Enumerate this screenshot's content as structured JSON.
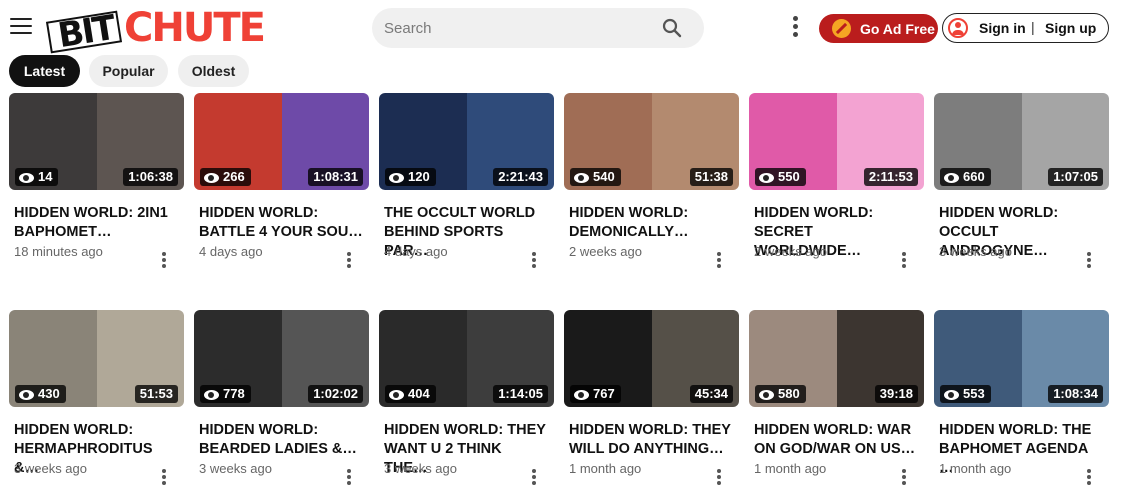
{
  "header": {
    "logo_text_1": "BIT",
    "logo_text_2": "CHUTE",
    "search_placeholder": "Search",
    "go_ad_free": "Go Ad Free",
    "sign_in": "Sign in",
    "separator": "|",
    "sign_up": "Sign up"
  },
  "colors": {
    "brand_red": "#ef4136",
    "ad_button": "#ba1d1d"
  },
  "tabs": [
    {
      "label": "Latest",
      "active": true
    },
    {
      "label": "Popular",
      "active": false
    },
    {
      "label": "Oldest",
      "active": false
    }
  ],
  "videos": [
    {
      "title": "HIDDEN WORLD: 2IN1 BAPHOMET…",
      "views": "14",
      "duration": "1:06:38",
      "age": "18 minutes ago"
    },
    {
      "title": "HIDDEN WORLD: BATTLE 4 YOUR SOU…",
      "views": "266",
      "duration": "1:08:31",
      "age": "4 days ago"
    },
    {
      "title": "THE OCCULT WORLD BEHIND SPORTS PAR…",
      "views": "120",
      "duration": "2:21:43",
      "age": "4 days ago"
    },
    {
      "title": "HIDDEN WORLD: DEMONICALLY…",
      "views": "540",
      "duration": "51:38",
      "age": "2 weeks ago"
    },
    {
      "title": "HIDDEN WORLD: SECRET WORLDWIDE…",
      "views": "550",
      "duration": "2:11:53",
      "age": "2 weeks ago"
    },
    {
      "title": "HIDDEN WORLD: OCCULT ANDROGYNE…",
      "views": "660",
      "duration": "1:07:05",
      "age": "3 weeks ago"
    },
    {
      "title": "HIDDEN WORLD: HERMAPHRODITUS &…",
      "views": "430",
      "duration": "51:53",
      "age": "3 weeks ago"
    },
    {
      "title": "HIDDEN WORLD: BEARDED LADIES &…",
      "views": "778",
      "duration": "1:02:02",
      "age": "3 weeks ago"
    },
    {
      "title": "HIDDEN WORLD: THEY WANT U 2 THINK THE…",
      "views": "404",
      "duration": "1:14:05",
      "age": "3 weeks ago"
    },
    {
      "title": "HIDDEN WORLD: THEY WILL DO ANYTHING…",
      "views": "767",
      "duration": "45:34",
      "age": "1 month ago"
    },
    {
      "title": "HIDDEN WORLD: WAR ON GOD/WAR ON US…",
      "views": "580",
      "duration": "39:18",
      "age": "1 month ago"
    },
    {
      "title": "HIDDEN WORLD: THE BAPHOMET AGENDA …",
      "views": "553",
      "duration": "1:08:34",
      "age": "1 month ago"
    }
  ]
}
